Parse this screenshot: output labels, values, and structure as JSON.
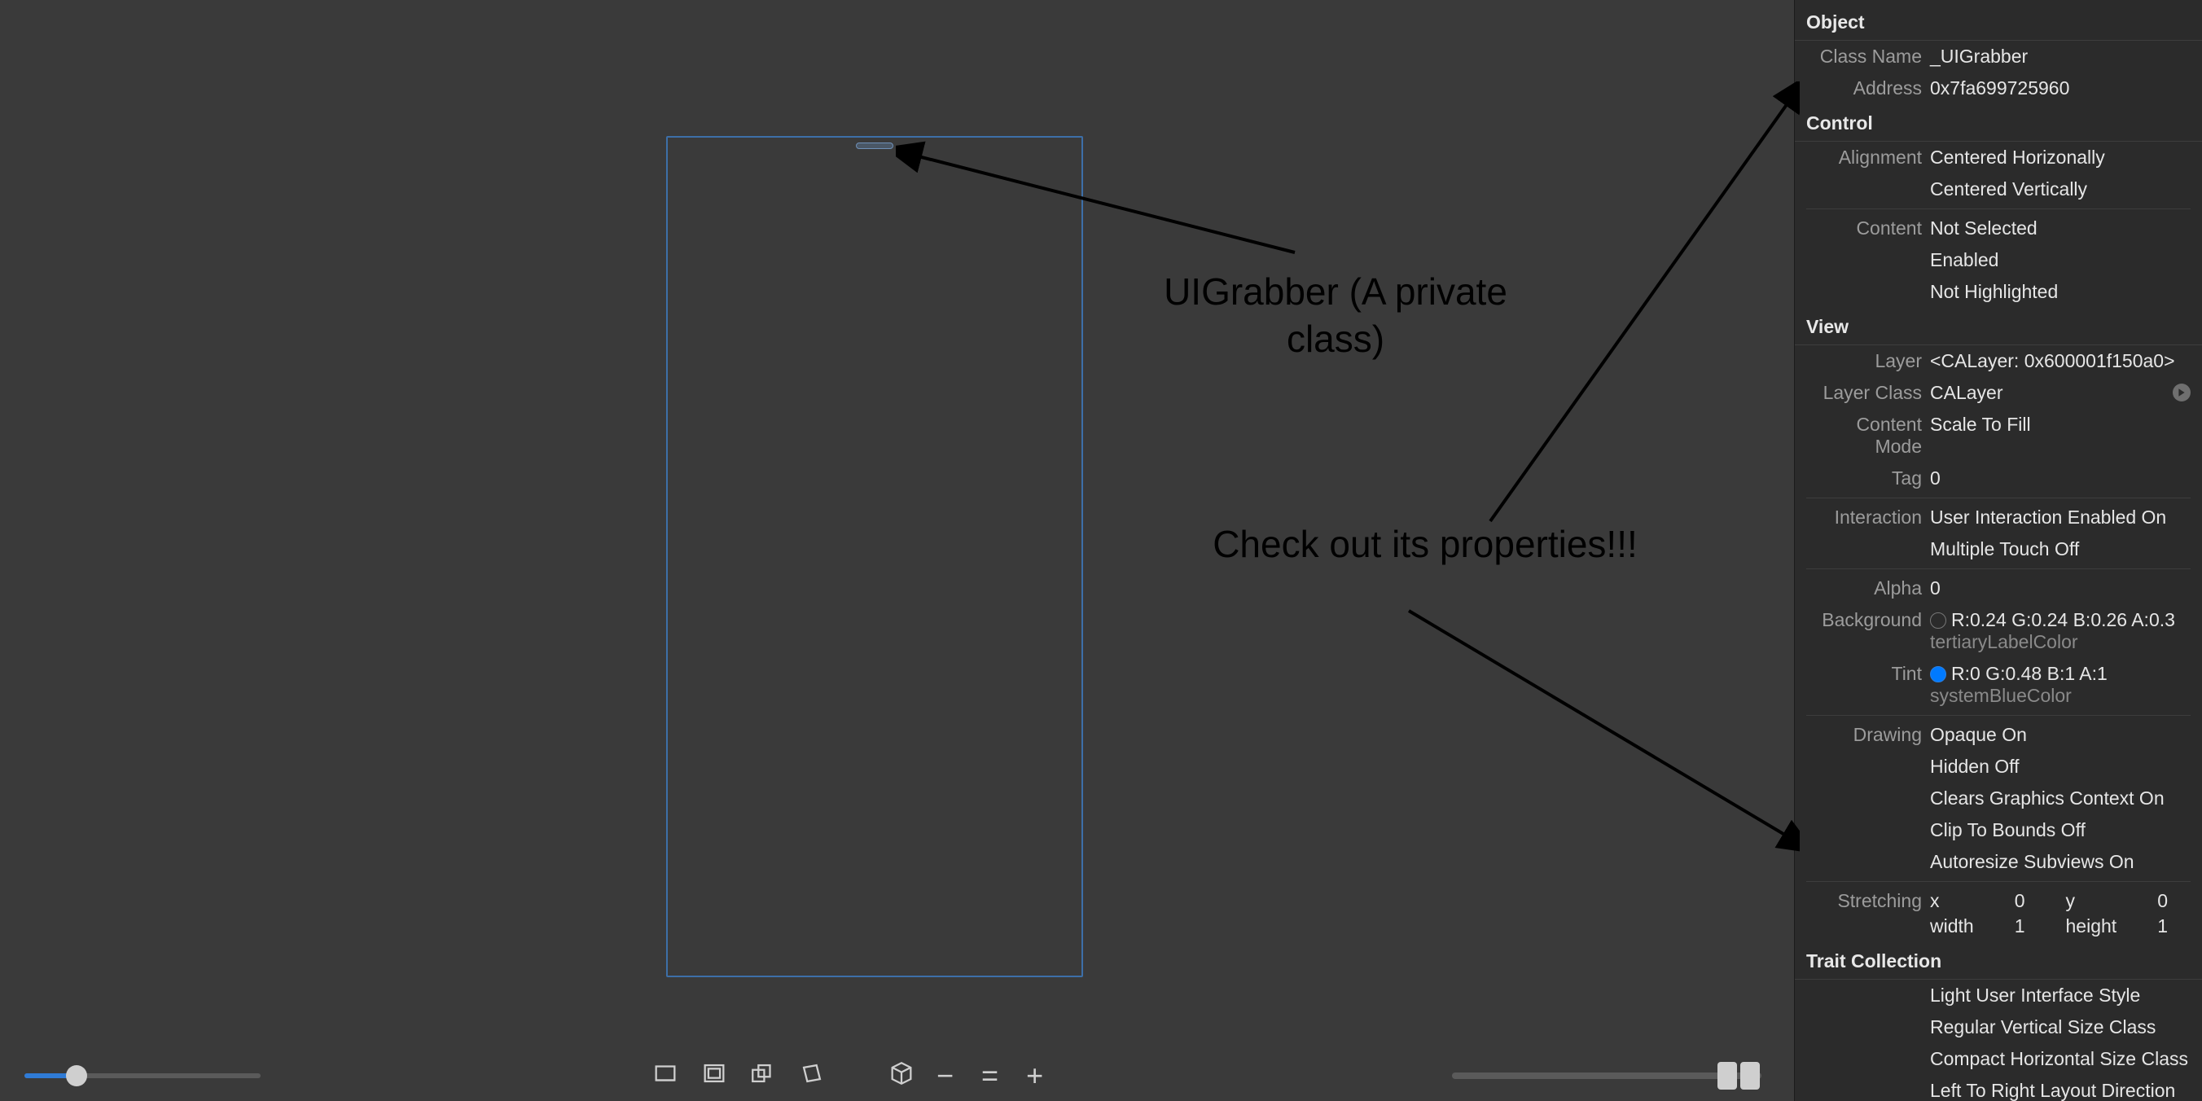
{
  "annotations": {
    "title1": "UIGrabber (A private class)",
    "title2": "Check out its properties!!!"
  },
  "inspector": {
    "object": {
      "header": "Object",
      "className_label": "Class Name",
      "className_value": "_UIGrabber",
      "address_label": "Address",
      "address_value": "0x7fa699725960"
    },
    "control": {
      "header": "Control",
      "alignment_label": "Alignment",
      "alignment_value1": "Centered Horizonally",
      "alignment_value2": "Centered Vertically",
      "content_label": "Content",
      "content_value1": "Not Selected",
      "content_value2": "Enabled",
      "content_value3": "Not Highlighted"
    },
    "view": {
      "header": "View",
      "layer_label": "Layer",
      "layer_value": "<CALayer: 0x600001f150a0>",
      "layerClass_label": "Layer Class",
      "layerClass_value": "CALayer",
      "contentMode_label": "Content Mode",
      "contentMode_value": "Scale To Fill",
      "tag_label": "Tag",
      "tag_value": "0",
      "interaction_label": "Interaction",
      "interaction_value1": "User Interaction Enabled On",
      "interaction_value2": "Multiple Touch Off",
      "alpha_label": "Alpha",
      "alpha_value": "0",
      "background_label": "Background",
      "background_value": "R:0.24 G:0.24 B:0.26 A:0.3",
      "background_sub": "tertiaryLabelColor",
      "tint_label": "Tint",
      "tint_value": "R:0 G:0.48 B:1 A:1",
      "tint_sub": "systemBlueColor",
      "drawing_label": "Drawing",
      "drawing_v1": "Opaque On",
      "drawing_v2": "Hidden Off",
      "drawing_v3": "Clears Graphics Context On",
      "drawing_v4": "Clip To Bounds Off",
      "drawing_v5": "Autoresize Subviews On",
      "stretching_label": "Stretching",
      "stretch_x_k": "x",
      "stretch_x_v": "0",
      "stretch_y_k": "y",
      "stretch_y_v": "0",
      "stretch_w_k": "width",
      "stretch_w_v": "1",
      "stretch_h_k": "height",
      "stretch_h_v": "1"
    },
    "trait": {
      "header": "Trait Collection",
      "v1": "Light User Interface Style",
      "v2": "Regular Vertical Size Class",
      "v3": "Compact Horizontal Size Class",
      "v4": "Left To Right Layout Direction"
    }
  }
}
